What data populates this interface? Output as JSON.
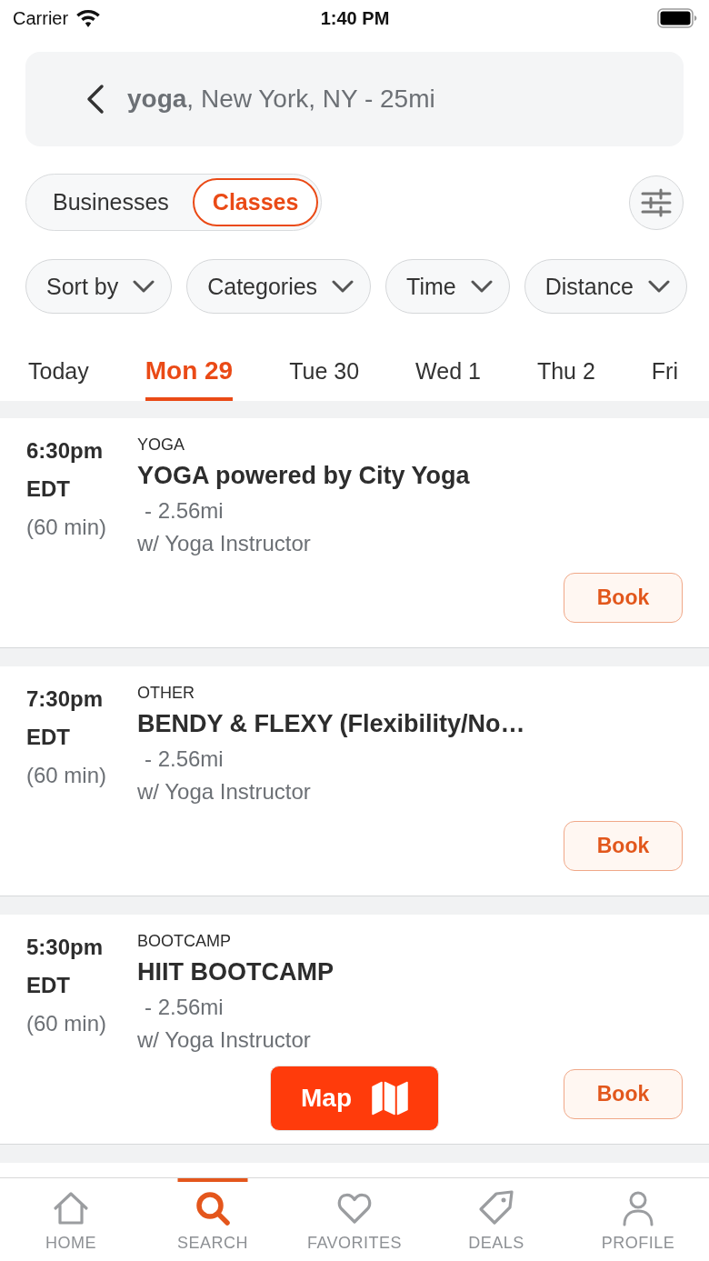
{
  "status_bar": {
    "carrier": "Carrier",
    "time": "1:40 PM"
  },
  "search_bar": {
    "text": "**yoga**, New York, NY - 25mi"
  },
  "segments": [
    {
      "label": "Businesses",
      "selected": false
    },
    {
      "label": "Classes",
      "selected": true
    }
  ],
  "filter_chips": [
    {
      "label": "Sort by"
    },
    {
      "label": "Categories"
    },
    {
      "label": "Time"
    },
    {
      "label": "Distance"
    }
  ],
  "date_tabs": [
    {
      "label": "Today",
      "selected": false
    },
    {
      "label": "Mon 29",
      "selected": true
    },
    {
      "label": "Tue 30",
      "selected": false
    },
    {
      "label": "Wed 1",
      "selected": false
    },
    {
      "label": "Thu 2",
      "selected": false
    },
    {
      "label": "Fri",
      "selected": false
    }
  ],
  "classes": [
    {
      "time": "6:30pm",
      "zone": "EDT",
      "duration": "(60 min)",
      "category": "YOGA",
      "title": "YOGA powered by City Yoga",
      "distance": "- 2.56mi",
      "instructor": "w/ Yoga Instructor",
      "action": "Book"
    },
    {
      "time": "7:30pm",
      "zone": "EDT",
      "duration": "(60 min)",
      "category": "OTHER",
      "title": "BENDY & FLEXY (Flexibility/No…",
      "distance": "- 2.56mi",
      "instructor": "w/ Yoga Instructor",
      "action": "Book"
    },
    {
      "time": "5:30pm",
      "zone": "EDT",
      "duration": "(60 min)",
      "category": "BOOTCAMP",
      "title": "HIIT BOOTCAMP",
      "distance": "- 2.56mi",
      "instructor": "w/ Yoga Instructor",
      "action": "Book"
    }
  ],
  "map_button": {
    "label": "Map"
  },
  "tab_bar": [
    {
      "label": "HOME",
      "selected": false
    },
    {
      "label": "SEARCH",
      "selected": true
    },
    {
      "label": "FAVORITES",
      "selected": false
    },
    {
      "label": "DEALS",
      "selected": false
    },
    {
      "label": "PROFILE",
      "selected": false
    }
  ]
}
